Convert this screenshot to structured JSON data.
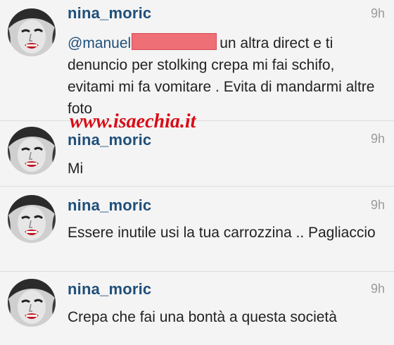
{
  "watermark": "www.isaechia.it",
  "comments": [
    {
      "username": "nina_moric",
      "time": "9h",
      "mention": "@manuel",
      "text": "un altra direct e ti denuncio per stolking crepa mi fai schifo, evitami mi fa vomitare . Evita di mandarmi altre foto"
    },
    {
      "username": "nina_moric",
      "time": "9h",
      "text": "Mi"
    },
    {
      "username": "nina_moric",
      "time": "9h",
      "text": "Essere inutile usi la tua carrozzina .. Pagliaccio"
    },
    {
      "username": "nina_moric",
      "time": "9h",
      "text": "Crepa che fai una bontà a questa società"
    }
  ],
  "colors": {
    "username": "#1f4f7a",
    "redaction": "#ee6f76",
    "watermark": "#d90b16"
  }
}
